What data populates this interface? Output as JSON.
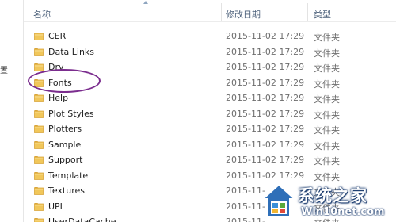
{
  "nav": {
    "fragment": "置"
  },
  "columns": {
    "name": "名称",
    "modified": "修改日期",
    "type": "类型"
  },
  "files": [
    {
      "name": "CER",
      "modified": "2015-11-02 17:29",
      "type": "文件夹"
    },
    {
      "name": "Data Links",
      "modified": "2015-11-02 17:29",
      "type": "文件夹"
    },
    {
      "name": "Drv",
      "modified": "2015-11-02 17:29",
      "type": "文件夹"
    },
    {
      "name": "Fonts",
      "modified": "2015-11-02 17:29",
      "type": "文件夹"
    },
    {
      "name": "Help",
      "modified": "2015-11-02 17:29",
      "type": "文件夹"
    },
    {
      "name": "Plot Styles",
      "modified": "2015-11-02 17:29",
      "type": "文件夹"
    },
    {
      "name": "Plotters",
      "modified": "2015-11-02 17:29",
      "type": "文件夹"
    },
    {
      "name": "Sample",
      "modified": "2015-11-02 17:29",
      "type": "文件夹"
    },
    {
      "name": "Support",
      "modified": "2015-11-02 17:29",
      "type": "文件夹"
    },
    {
      "name": "Template",
      "modified": "2015-11-02 17:29",
      "type": "文件夹"
    },
    {
      "name": "Textures",
      "modified": "2015-11-",
      "type": "文件夹"
    },
    {
      "name": "UPI",
      "modified": "2015-11-",
      "type": "文件夹"
    },
    {
      "name": "UserDataCache",
      "modified": "2015-11-",
      "type": "文件夹"
    }
  ],
  "watermark": {
    "title": "系统之家",
    "url": "Win10net.com"
  },
  "colors": {
    "folder_body": "#f1c75a",
    "folder_dark": "#d9a53a",
    "annotation": "#7b2d8e",
    "header_text": "#4c607a"
  },
  "icons": {
    "folder": "folder-icon",
    "sort": "sort-up-icon",
    "logo": "house-logo-icon"
  }
}
